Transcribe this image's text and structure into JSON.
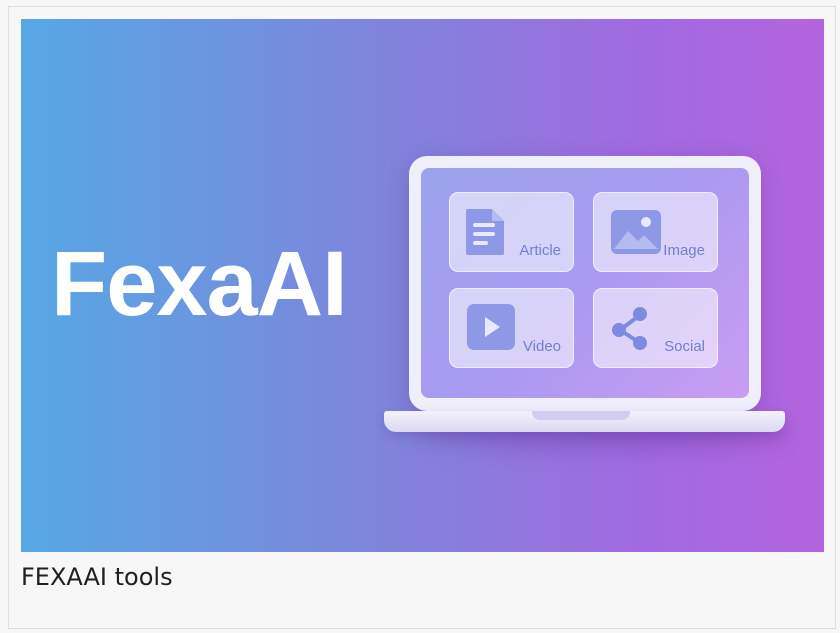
{
  "hero": {
    "brand": "FexaAI",
    "tiles": [
      {
        "label": "Article",
        "icon": "article-icon"
      },
      {
        "label": "Image",
        "icon": "image-icon"
      },
      {
        "label": "Video",
        "icon": "video-icon"
      },
      {
        "label": "Social",
        "icon": "share-icon"
      }
    ]
  },
  "caption": "FEXAAI tools",
  "colors": {
    "gradient_start": "#56a8e5",
    "gradient_end": "#b364de",
    "icon": "#7d8ae0",
    "label": "#6f7fd2"
  }
}
